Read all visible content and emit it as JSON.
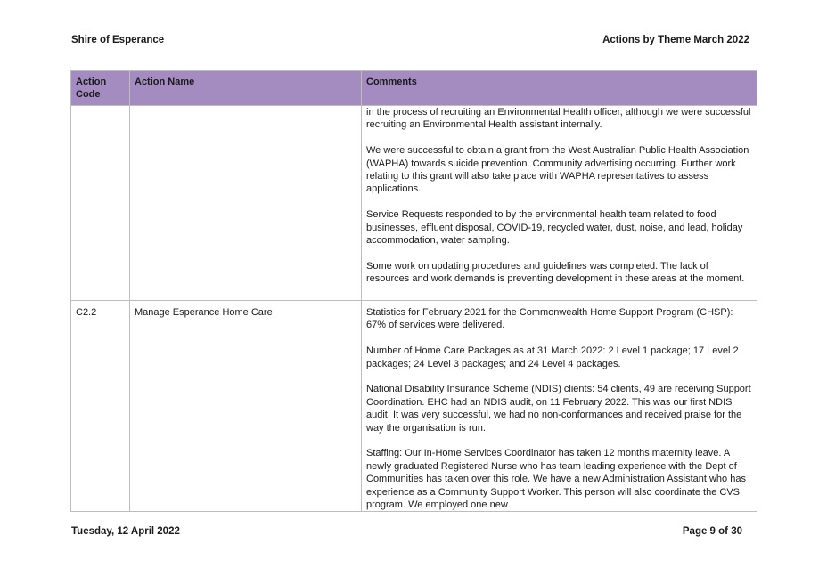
{
  "header": {
    "org": "Shire of Esperance",
    "doc_title": "Actions by Theme March 2022"
  },
  "table": {
    "columns": [
      "Action Code",
      "Action Name",
      "Comments"
    ],
    "rows": [
      {
        "code": "",
        "name": "",
        "comments": [
          "in the process of recruiting an Environmental Health officer, although we were successful recruiting an Environmental Health assistant internally.",
          "We were successful to obtain a grant from the West Australian Public Health Association (WAPHA) towards suicide prevention. Community advertising occurring. Further work relating to this grant will also take place with WAPHA representatives to assess applications.",
          "Service Requests responded to by the environmental health team related to food businesses, effluent disposal, COVID-19, recycled water, dust, noise, and lead, holiday accommodation, water sampling.",
          "Some work on updating procedures and guidelines was completed. The lack of resources and work demands is preventing development in these areas at the moment."
        ]
      },
      {
        "code": "C2.2",
        "name": "Manage Esperance Home Care",
        "comments": [
          "Statistics for February 2021 for the Commonwealth Home Support Program (CHSP): 67% of services were delivered.",
          "Number of Home Care Packages as at 31 March 2022: 2 Level 1 package; 17 Level 2 packages; 24 Level 3 packages; and 24 Level 4 packages.",
          "National Disability Insurance Scheme (NDIS) clients: 54 clients, 49 are receiving Support Coordination. EHC had an NDIS audit, on 11 February 2022. This was our first NDIS audit. It was very successful, we had no non-conformances and received praise for the way the organisation is run.",
          "Staffing: Our In-Home Services Coordinator has taken 12 months maternity leave. A newly graduated Registered Nurse who has team leading experience with the Dept of Communities has taken over this role. We have a new Administration Assistant who has experience as a Community Support Worker. This person will also coordinate the CVS program. We employed one new"
        ]
      }
    ]
  },
  "footer": {
    "date": "Tuesday, 12 April 2022",
    "page_label": "Page 9 of 30"
  },
  "colors": {
    "header_fill": "#a48cc0",
    "grid_line": "#bdbdbd"
  }
}
